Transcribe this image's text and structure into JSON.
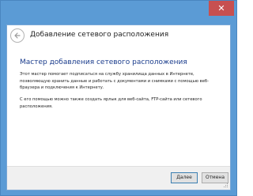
{
  "window": {
    "close_glyph": "✕"
  },
  "header": {
    "title": "Добавление сетевого расположения",
    "back_icon": "back-arrow-icon"
  },
  "main": {
    "heading": "Мастер добавления сетевого расположения",
    "paragraph_1": "Этот мастер помогает подписаться на службу хранилища данных в Интернете, позволяющую хранить данные и работать с документами и снимками с помощью веб-браузера и подключения к Интернету.",
    "paragraph_2": "С его помощью можно также создать ярлык для веб-сайта, FTP-сайта или сетевого расположения."
  },
  "footer": {
    "next_label": "Далее",
    "cancel_label": "Отмена"
  },
  "colors": {
    "frame": "#5b9bd5",
    "heading": "#1a3c8c",
    "close": "#c75050"
  }
}
